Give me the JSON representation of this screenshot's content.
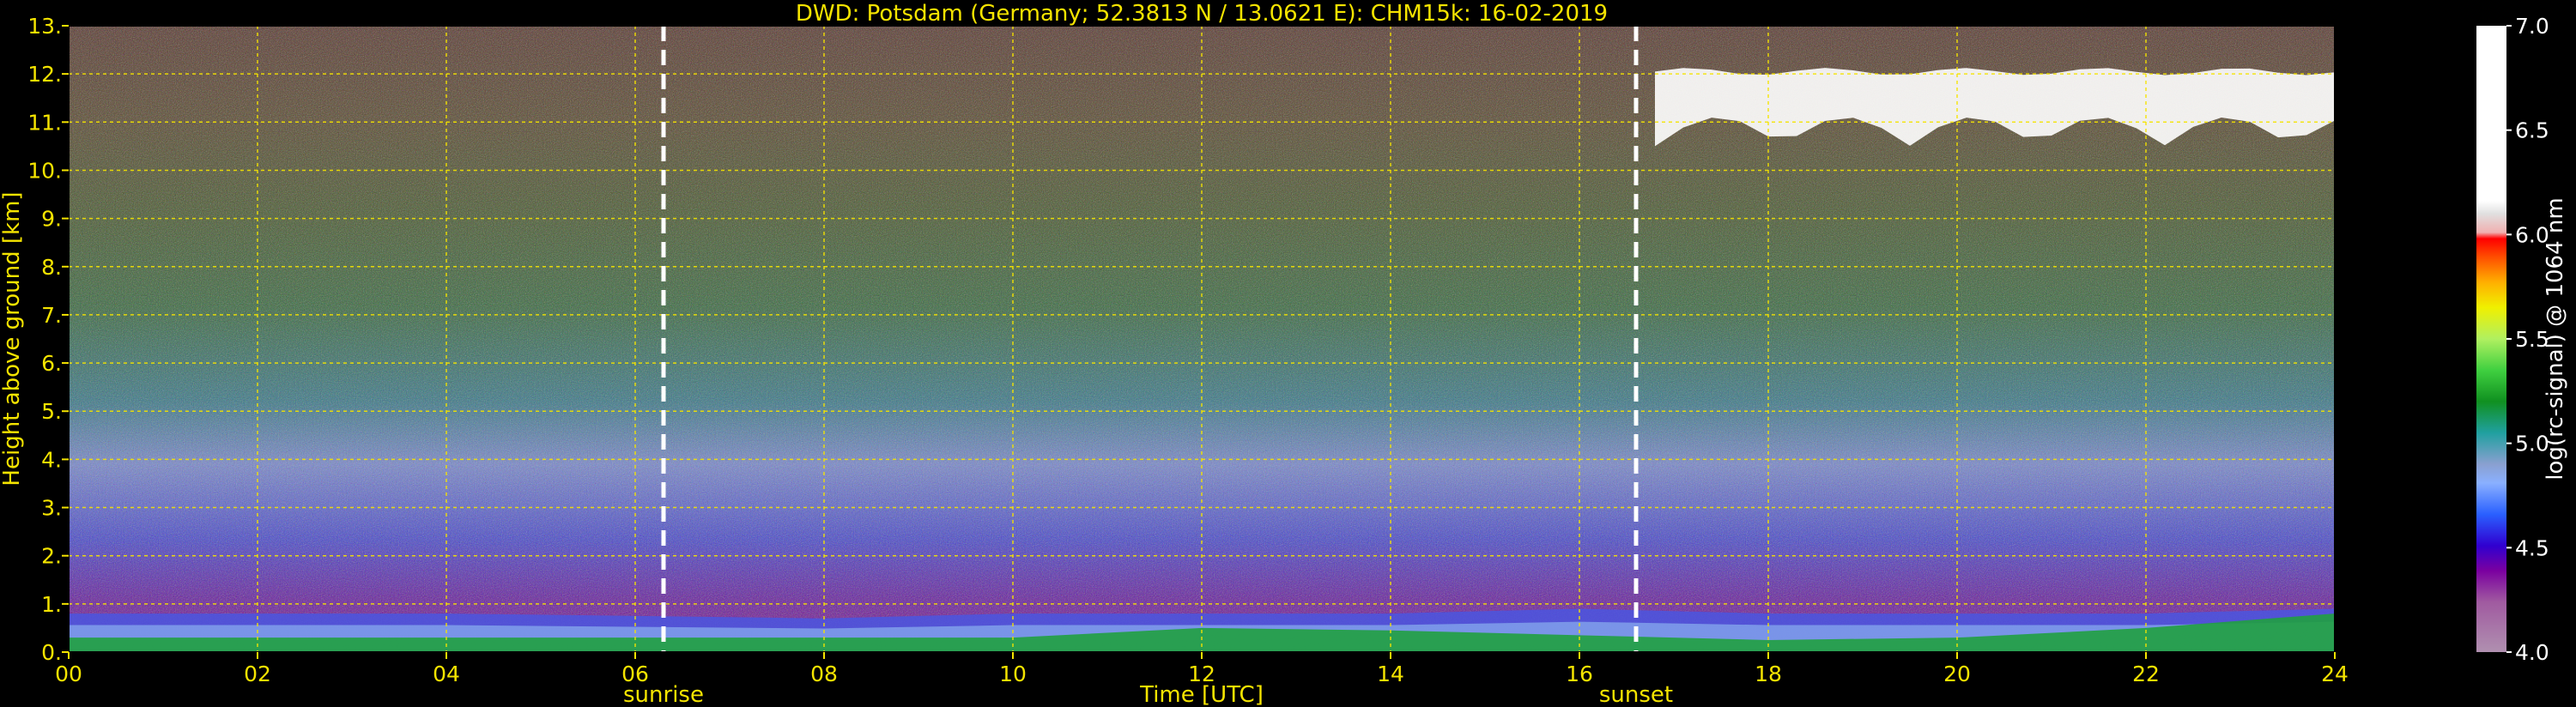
{
  "chart_data": {
    "type": "heatmap",
    "title": "DWD: Potsdam (Germany; 52.3813 N / 13.0621 E):    CHM15k: 16-02-2019",
    "xlabel": "Time [UTC]",
    "ylabel": "Height above ground [km]",
    "xlim": [
      0,
      24
    ],
    "ylim": [
      0,
      13
    ],
    "x_ticks": [
      "00",
      "02",
      "04",
      "06",
      "08",
      "10",
      "12",
      "14",
      "16",
      "18",
      "20",
      "22",
      "24"
    ],
    "y_ticks": [
      "0.",
      "1.",
      "2.",
      "3.",
      "4.",
      "5.",
      "6.",
      "7.",
      "8.",
      "9.",
      "10.",
      "11.",
      "12.",
      "13."
    ],
    "grid": true,
    "events": [
      {
        "label": "sunrise",
        "time": 6.3
      },
      {
        "label": "sunset",
        "time": 16.6
      }
    ],
    "colorbar": {
      "label": "log(rc-signal) @ 1064 nm",
      "range": [
        4.0,
        7.0
      ],
      "ticks": [
        "4.0",
        "4.5",
        "5.0",
        "5.5",
        "6.0",
        "6.5",
        "7.0"
      ]
    },
    "features": {
      "boundary_layer_top_km": {
        "x": [
          0,
          4,
          8,
          10,
          12,
          14,
          16,
          18,
          20,
          22,
          24
        ],
        "y": [
          0.8,
          0.8,
          0.7,
          0.8,
          0.8,
          0.8,
          0.9,
          0.8,
          0.8,
          0.8,
          0.9
        ]
      },
      "surface_layer_km": {
        "x": [
          0,
          6,
          10,
          12,
          14,
          16,
          18,
          20,
          22,
          24
        ],
        "y": [
          0.3,
          0.3,
          0.3,
          0.5,
          0.45,
          0.35,
          0.25,
          0.3,
          0.5,
          0.8
        ]
      },
      "cirrus_cloud": {
        "time_range": [
          16.8,
          24
        ],
        "height_range_km": [
          10.2,
          12.2
        ]
      }
    }
  }
}
